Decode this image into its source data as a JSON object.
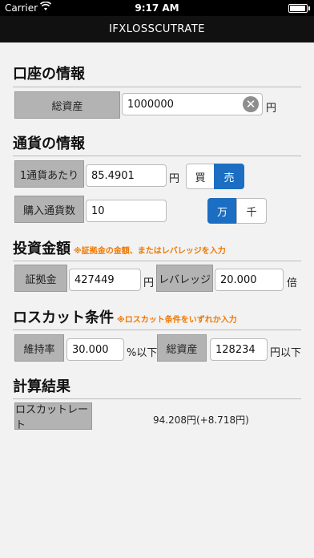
{
  "status": {
    "carrier": "Carrier",
    "time": "9:17 AM"
  },
  "nav": {
    "title": "IFXLOSSCUTRATE"
  },
  "account": {
    "title": "口座の情報",
    "total_assets_label": "総資産",
    "total_assets_value": "1000000",
    "total_assets_unit": "円",
    "clear_symbol": "✕"
  },
  "currency": {
    "title": "通貨の情報",
    "per_unit_label": "1通貨あたり",
    "per_unit_value": "85.4901",
    "per_unit_unit": "円",
    "buy_label": "買",
    "sell_label": "売",
    "quantity_label": "購入通貨数",
    "quantity_value": "10",
    "man_label": "万",
    "sen_label": "千"
  },
  "investment": {
    "title": "投資金額",
    "note": "※証拠金の金額、またはレバレッジを入力",
    "margin_label": "証拠金",
    "margin_value": "427449",
    "margin_unit": "円",
    "leverage_label": "レバレッジ",
    "leverage_value": "20.000",
    "leverage_unit": "倍"
  },
  "losscut": {
    "title": "ロスカット条件",
    "note": "※ロスカット条件をいずれか入力",
    "maintenance_label": "維持率",
    "maintenance_value": "30.000",
    "maintenance_unit": "%以下",
    "assets_label": "総資産",
    "assets_value": "128234",
    "assets_unit": "円以下"
  },
  "result": {
    "title": "計算結果",
    "rate_label": "ロスカットレート",
    "rate_value": "94.208円(+8.718円)"
  },
  "colors": {
    "accent": "#1b6ec2",
    "note": "#f07800",
    "label_bg": "#b3b3b3"
  }
}
